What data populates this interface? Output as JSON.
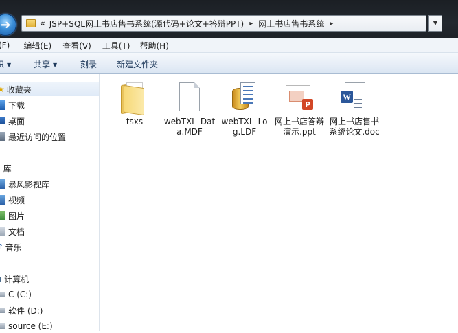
{
  "address_bar": {
    "prefix": "«",
    "segments": [
      "JSP+SQL网上书店售书系统(源代码+论文+答辩PPT)",
      "网上书店售书系统"
    ],
    "separator": "▸"
  },
  "menu": {
    "items": [
      "(F)",
      "编辑(E)",
      "查看(V)",
      "工具(T)",
      "帮助(H)"
    ]
  },
  "command_bar": {
    "items": [
      "织",
      "共享",
      "刻录",
      "新建文件夹"
    ]
  },
  "navigation": {
    "favorites_header": "收藏夹",
    "favorites": [
      "下载",
      "桌面",
      "最近访问的位置"
    ],
    "library_header": "库",
    "libraries": [
      "暴风影视库",
      "视频",
      "图片",
      "文档",
      "音乐"
    ],
    "computer_header": "计算机",
    "drives": [
      "C (C:)",
      "软件 (D:)",
      "source (E:)"
    ]
  },
  "files": [
    {
      "name": "tsxs",
      "icon": "folder-icon"
    },
    {
      "name": "webTXL_Data.MDF",
      "icon": "mdf-file-icon"
    },
    {
      "name": "webTXL_Log.LDF",
      "icon": "database-log-icon"
    },
    {
      "name": "网上书店答辩演示.ppt",
      "icon": "powerpoint-file-icon"
    },
    {
      "name": "网上书店售书系统论文.doc",
      "icon": "word-file-icon"
    }
  ]
}
